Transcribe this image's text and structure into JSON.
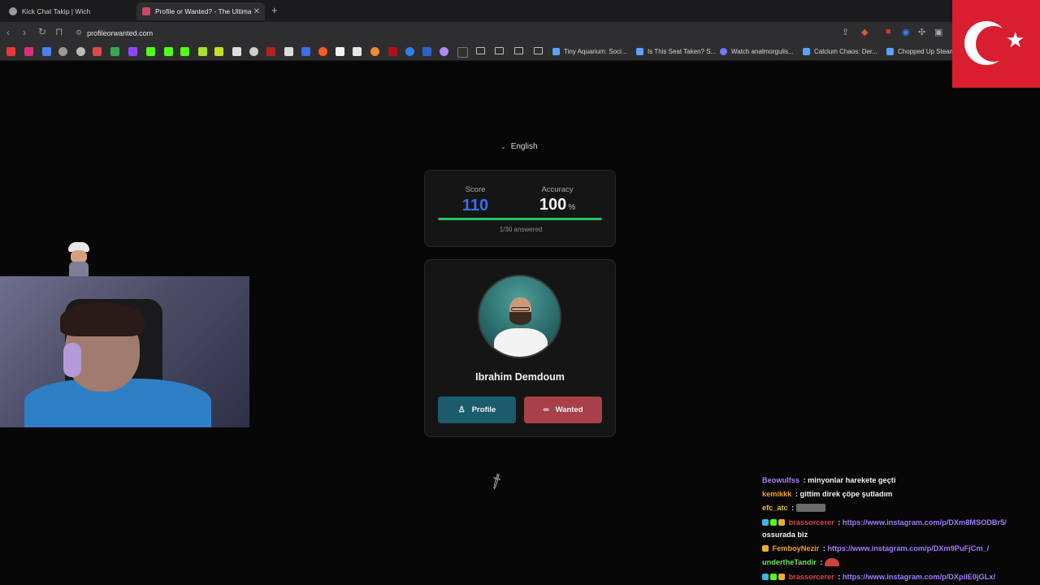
{
  "browser": {
    "tabs": [
      {
        "title": "Kick Chat Takip | Wich",
        "active": false
      },
      {
        "title": "Profile or Wanted? - The Ultimat",
        "active": true
      }
    ],
    "address": "profileorwanted.com",
    "bookmarks": [
      "Tiny Aquarium: Soci...",
      "Is This Seat Taken? S...",
      "Watch analmorgulis...",
      "Calcium Chaos: Der...",
      "Chopped Up Steam"
    ]
  },
  "page": {
    "language": "English",
    "score": {
      "label": "Score",
      "value": "110"
    },
    "accuracy": {
      "label": "Accuracy",
      "value": "100",
      "unit": "%"
    },
    "progress": {
      "fraction": 0.0333,
      "text": "1/30 answered"
    },
    "person_name": "Ibrahim Demdoum",
    "buttons": {
      "profile": "Profile",
      "wanted": "Wanted"
    }
  },
  "chat": {
    "messages": [
      {
        "user": "Beowulfss",
        "user_color": "#b57cff",
        "text": "minyonlar harekete geçti"
      },
      {
        "user": "kemikkk",
        "user_color": "#f0a030",
        "text": "gittim direk çöpe şutladım"
      },
      {
        "user": "efc_atc",
        "user_color": "#e0c040",
        "text": ""
      },
      {
        "user": "brassorcerer",
        "user_color": "#e0404a",
        "text": "https://www.instagram.com/p/DXm8MSODBr5/"
      },
      {
        "user": "",
        "user_color": "#f2f2f2",
        "text": "ossurada biz"
      },
      {
        "user": "FemboyNezir",
        "user_color": "#f0a030",
        "text": "https://www.instagram.com/p/DXm9PuFjCm_/"
      },
      {
        "user": "undertheTandir",
        "user_color": "#6ee05a",
        "text": ""
      },
      {
        "user": "brassorcerer",
        "user_color": "#e0404a",
        "text": "https://www.instagram.com/p/DXpiIE0jGLx/"
      }
    ]
  },
  "colors": {
    "score_blue": "#3b6df2",
    "progress_green": "#22c55e",
    "profile_button": "#1c5b6b",
    "wanted_button": "#a8404a"
  }
}
